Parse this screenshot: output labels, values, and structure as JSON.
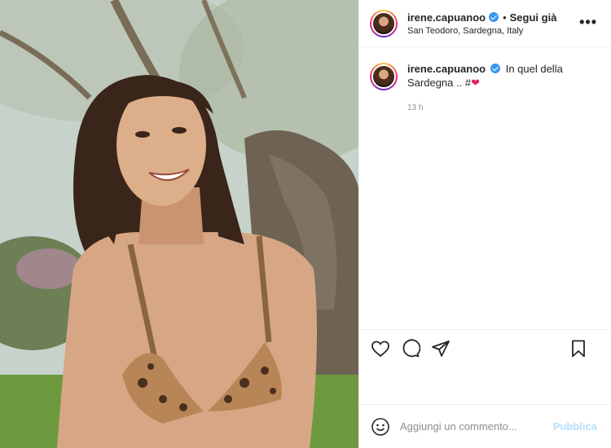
{
  "post": {
    "username": "irene.capuanoo",
    "follow_status": "Segui già",
    "separator": "•",
    "location": "San Teodoro, Sardegna, Italy",
    "more_icon": "more-horizontal-icon"
  },
  "caption": {
    "username": "irene.capuanoo",
    "text": "In quel della Sardegna .. #",
    "emoji": "❤",
    "time": "13 h"
  },
  "actions": {
    "like_icon": "heart-icon",
    "comment_icon": "comment-icon",
    "share_icon": "share-icon",
    "save_icon": "bookmark-icon"
  },
  "comment": {
    "placeholder": "Aggiungi un commento...",
    "publish_label": "Pubblica",
    "emoji_icon": "smiley-icon"
  },
  "colors": {
    "verified": "#3897f0",
    "publish_disabled": "#b2dffc",
    "heart": "#e0245e"
  }
}
